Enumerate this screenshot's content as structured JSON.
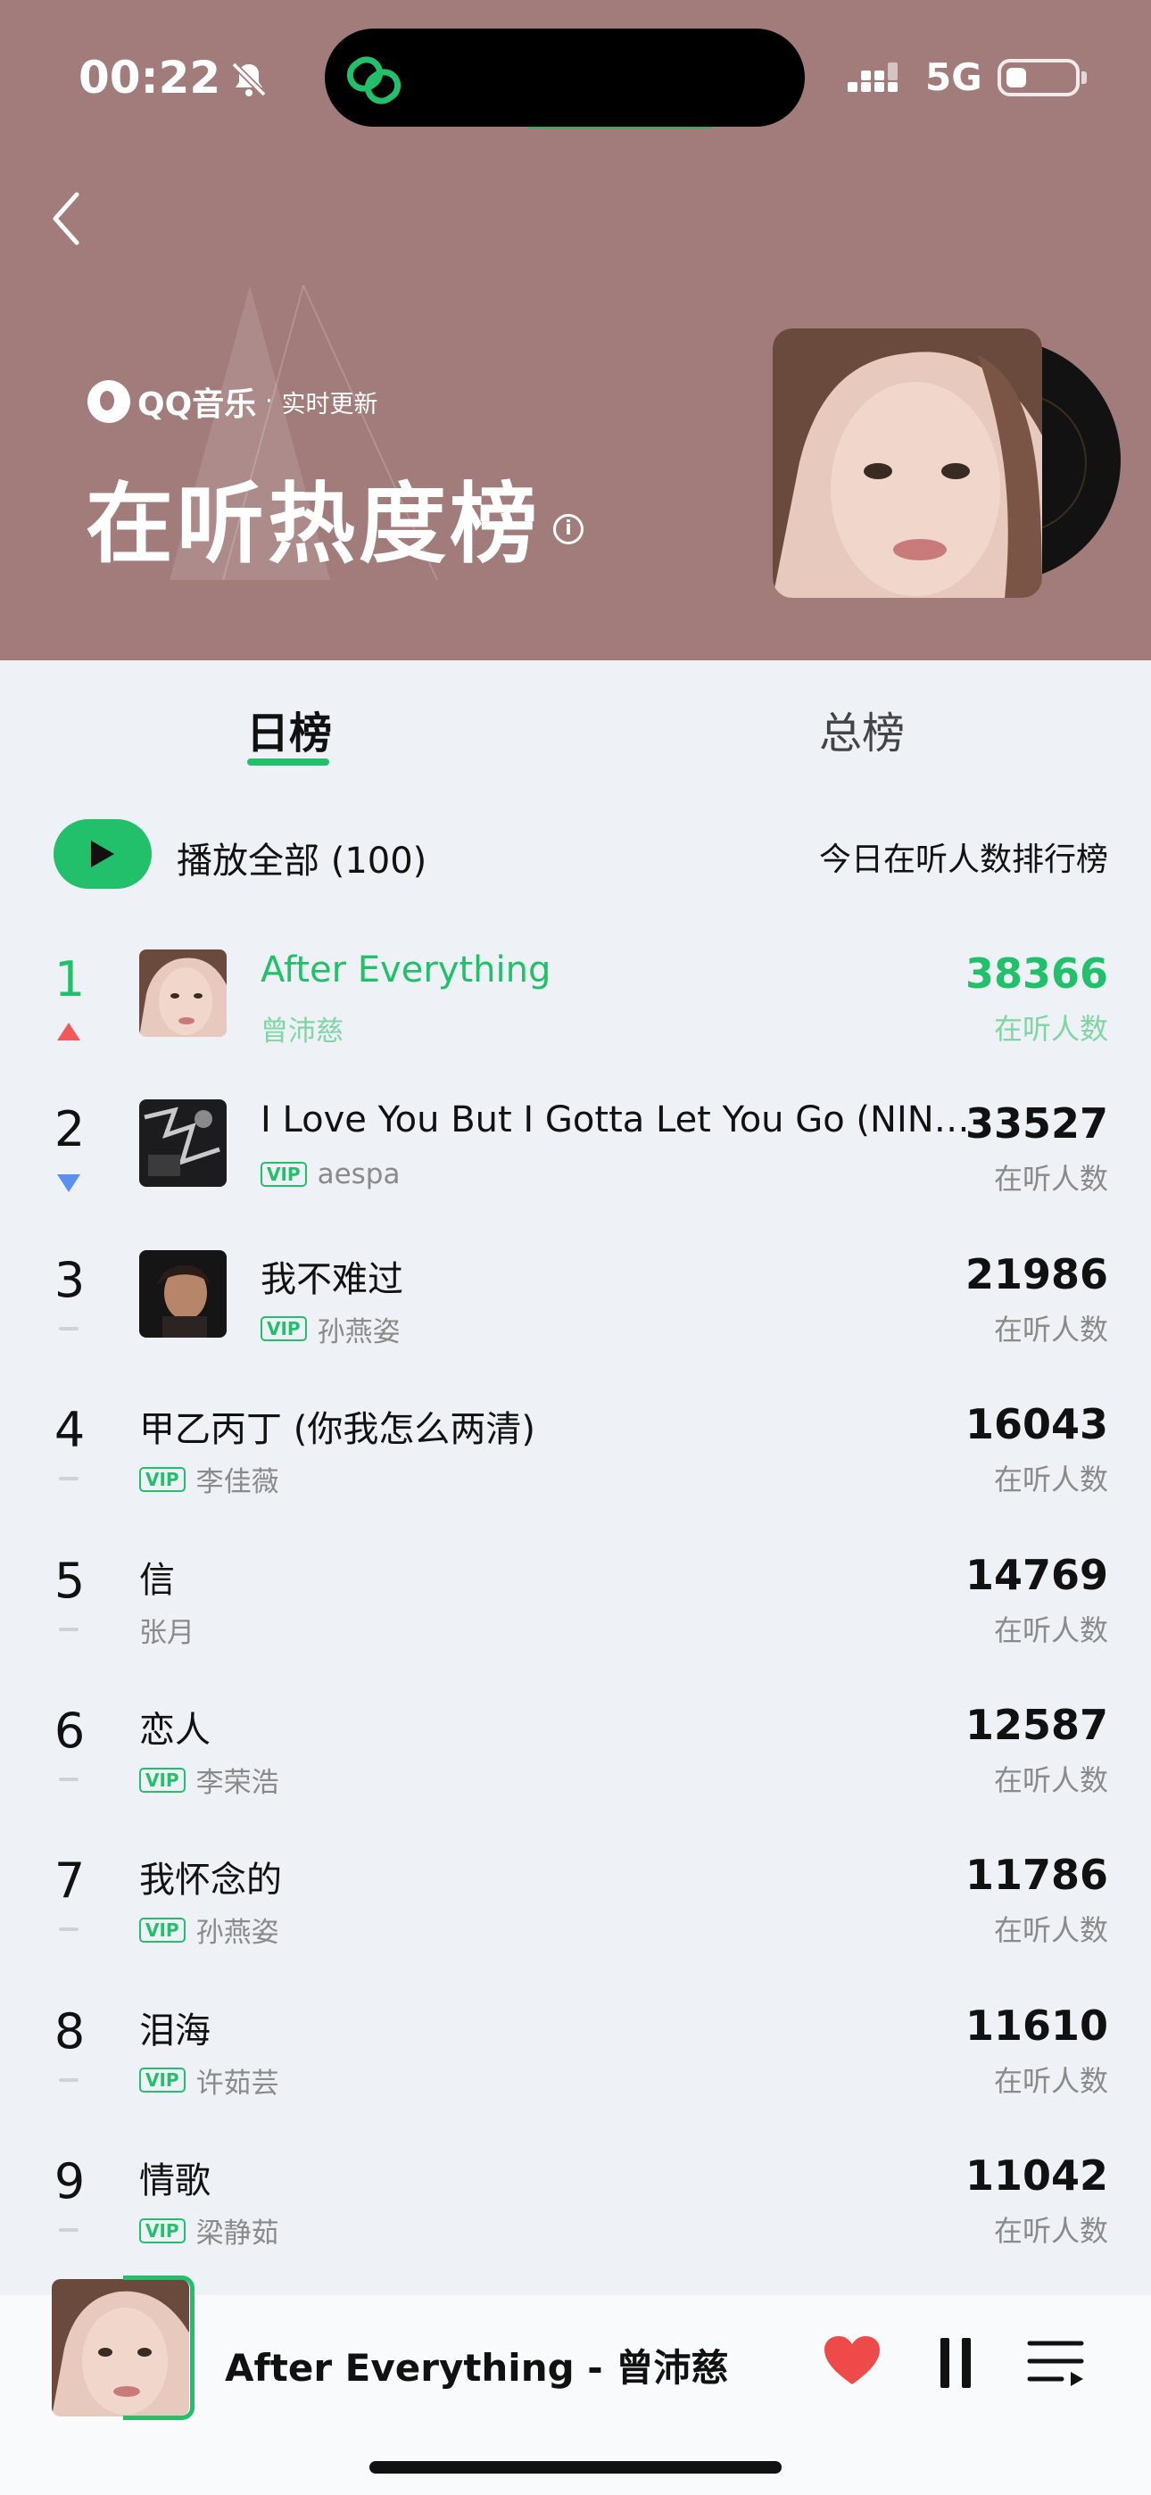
{
  "status_bar": {
    "time": "00:22",
    "network": "5G"
  },
  "header": {
    "brand_name": "QQ音乐",
    "brand_dot": "·",
    "brand_subtitle": "实时更新",
    "title": "在听热度榜",
    "info_glyph": "i",
    "background_color": "#a27b7b"
  },
  "tabs": [
    {
      "label": "日榜",
      "active": true
    },
    {
      "label": "总榜",
      "active": false
    }
  ],
  "play_all": {
    "label": "播放全部 (100)",
    "ranking_desc": "今日在听人数排行榜"
  },
  "songs": [
    {
      "rank": "1",
      "trend": "up",
      "title": "After Everything",
      "artist": "曾沛慈",
      "vip": false,
      "listeners": "38366",
      "listeners_label": "在听人数",
      "playing": true,
      "thumb": "cover-portrait"
    },
    {
      "rank": "2",
      "trend": "down",
      "title": "I Love You But I Gotta Let You Go (NINGNING Solo)",
      "artist": "aespa",
      "vip": true,
      "listeners": "33527",
      "listeners_label": "在听人数",
      "playing": false,
      "thumb": "cover-dark-graphic"
    },
    {
      "rank": "3",
      "trend": "same",
      "title": "我不难过",
      "artist": "孙燕姿",
      "vip": true,
      "listeners": "21986",
      "listeners_label": "在听人数",
      "playing": false,
      "thumb": "cover-dark-portrait"
    },
    {
      "rank": "4",
      "trend": "same",
      "title": "甲乙丙丁 (你我怎么两清)",
      "artist": "李佳薇",
      "vip": true,
      "listeners": "16043",
      "listeners_label": "在听人数",
      "playing": false
    },
    {
      "rank": "5",
      "trend": "same",
      "title": "信",
      "artist": "张月",
      "vip": false,
      "listeners": "14769",
      "listeners_label": "在听人数",
      "playing": false
    },
    {
      "rank": "6",
      "trend": "same",
      "title": "恋人",
      "artist": "李荣浩",
      "vip": true,
      "listeners": "12587",
      "listeners_label": "在听人数",
      "playing": false
    },
    {
      "rank": "7",
      "trend": "same",
      "title": "我怀念的",
      "artist": "孙燕姿",
      "vip": true,
      "listeners": "11786",
      "listeners_label": "在听人数",
      "playing": false
    },
    {
      "rank": "8",
      "trend": "same",
      "title": "泪海",
      "artist": "许茹芸",
      "vip": true,
      "listeners": "11610",
      "listeners_label": "在听人数",
      "playing": false
    },
    {
      "rank": "9",
      "trend": "same",
      "title": "情歌",
      "artist": "梁静茹",
      "vip": true,
      "listeners": "11042",
      "listeners_label": "在听人数",
      "playing": false
    }
  ],
  "vip_badge": "VIP",
  "now_playing": {
    "title": "After Everything - 曾沛慈"
  },
  "colors": {
    "accent": "#22c06b",
    "trend_up": "#f05a5a",
    "trend_down": "#5b8ff2"
  }
}
